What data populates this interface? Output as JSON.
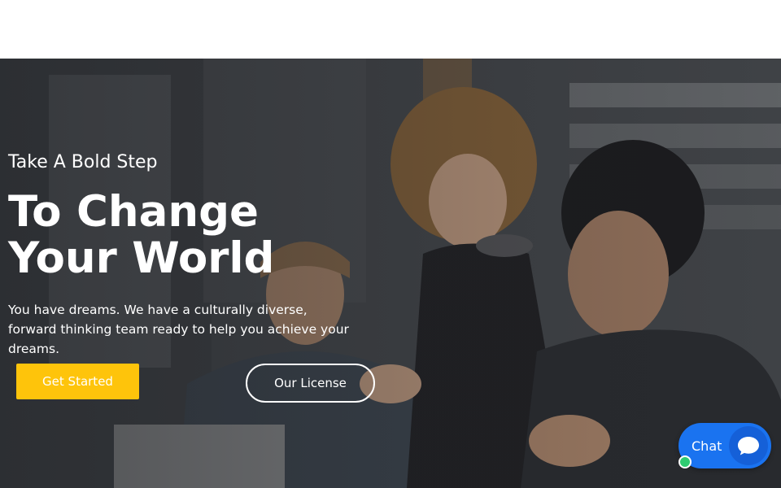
{
  "hero": {
    "eyebrow": "Take A Bold Step",
    "headline": "To Change Your World",
    "subtext": "You have dreams. We have a culturally diverse, forward thinking team ready to help you achieve your dreams.",
    "primary_button": "Get Started",
    "secondary_button": "Our License"
  },
  "chat": {
    "label": "Chat",
    "icon": "chat-bubble-icon",
    "status_icon": "online-status-dot"
  },
  "colors": {
    "accent": "#fec40b",
    "chat_blue": "#1a73f0",
    "online": "#2ecc71"
  }
}
